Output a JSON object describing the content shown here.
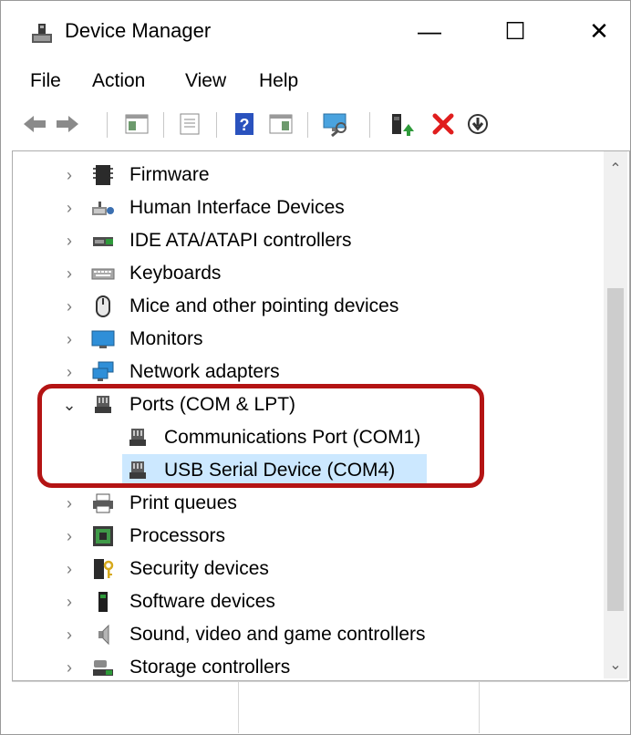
{
  "window": {
    "title": "Device Manager",
    "minimize_glyph": "—",
    "maximize_glyph": "☐",
    "close_glyph": "✕"
  },
  "menu": [
    "File",
    "Action",
    "View",
    "Help"
  ],
  "toolbar": {
    "buttons": [
      "back-icon",
      "forward-icon",
      "show-hide-console-tree-icon",
      "properties-icon",
      "help-icon",
      "action-pane-icon",
      "scan-hardware-icon",
      "update-driver-icon",
      "uninstall-device-icon",
      "disable-device-icon"
    ]
  },
  "tree": {
    "items": [
      {
        "label": "Firmware",
        "icon": "chip-icon",
        "expanded": false,
        "level": 0
      },
      {
        "label": "Human Interface Devices",
        "icon": "hid-icon",
        "expanded": false,
        "level": 0
      },
      {
        "label": "IDE ATA/ATAPI controllers",
        "icon": "ide-controller-icon",
        "expanded": false,
        "level": 0
      },
      {
        "label": "Keyboards",
        "icon": "keyboard-icon",
        "expanded": false,
        "level": 0
      },
      {
        "label": "Mice and other pointing devices",
        "icon": "mouse-icon",
        "expanded": false,
        "level": 0
      },
      {
        "label": "Monitors",
        "icon": "monitor-icon",
        "expanded": false,
        "level": 0
      },
      {
        "label": "Network adapters",
        "icon": "network-adapter-icon",
        "expanded": false,
        "level": 0
      },
      {
        "label": "Ports (COM & LPT)",
        "icon": "port-icon",
        "expanded": true,
        "level": 0
      },
      {
        "label": "Communications Port (COM1)",
        "icon": "port-icon",
        "level": 1
      },
      {
        "label": "USB Serial Device (COM4)",
        "icon": "port-icon",
        "level": 1,
        "selected": true
      },
      {
        "label": "Print queues",
        "icon": "printer-icon",
        "expanded": false,
        "level": 0
      },
      {
        "label": "Processors",
        "icon": "processor-icon",
        "expanded": false,
        "level": 0
      },
      {
        "label": "Security devices",
        "icon": "security-device-icon",
        "expanded": false,
        "level": 0
      },
      {
        "label": "Software devices",
        "icon": "software-device-icon",
        "expanded": false,
        "level": 0
      },
      {
        "label": "Sound, video and game controllers",
        "icon": "speaker-icon",
        "expanded": false,
        "level": 0
      },
      {
        "label": "Storage controllers",
        "icon": "storage-controller-icon",
        "expanded": false,
        "level": 0
      }
    ]
  },
  "colors": {
    "selection": "#cce8ff",
    "highlight_border": "#b41414"
  }
}
